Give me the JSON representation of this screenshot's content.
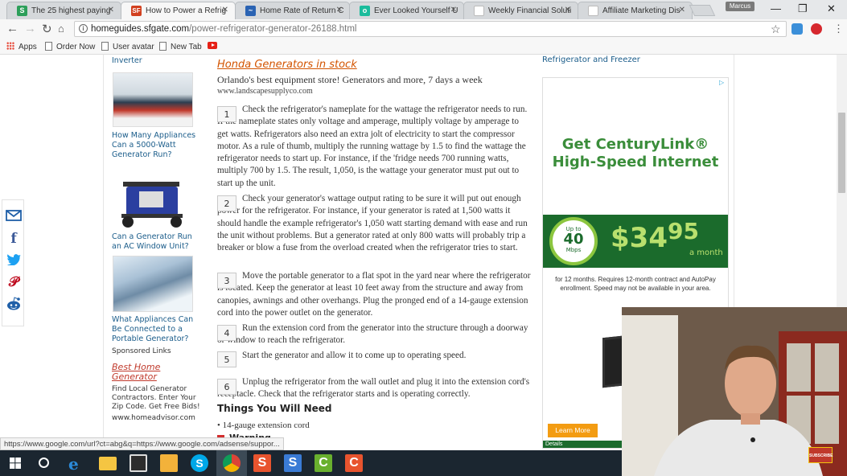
{
  "browser": {
    "tabs": [
      {
        "title": "The 25 highest paying",
        "fav": "S",
        "fav_color": "#2d9f5a"
      },
      {
        "title": "How to Power a Refrig",
        "fav": "SF",
        "fav_color": "#d2401f"
      },
      {
        "title": "Home Rate of Return C",
        "fav": "~",
        "fav_color": "#2a63b3"
      },
      {
        "title": "Ever Looked Yourself U",
        "fav": "o",
        "fav_color": "#1abc9c"
      },
      {
        "title": "Weekly Financial Soluti",
        "fav": "",
        "fav_color": "#cccccc"
      },
      {
        "title": "Affiliate Marketing Dis",
        "fav": "",
        "fav_color": "#cccccc"
      }
    ],
    "user_chip": "Marcus",
    "url_domain": "homeguides.sfgate.com",
    "url_path": "/power-refrigerator-generator-26188.html",
    "bookmarks": [
      "Apps",
      "Order Now",
      "User avatar",
      "New Tab"
    ],
    "status_url": "https://www.google.com/url?ct=abg&q=https://www.google.com/adsense/suppor..."
  },
  "left_column": {
    "top_link": "Inverter",
    "related": [
      "How Many Appliances Can a 5000-Watt Generator Run?",
      "Can a Generator Run an AC Window Unit?",
      "What Appliances Can Be Connected to a Portable Generator?"
    ],
    "sponsored_label": "Sponsored Links",
    "sponsored_title": "Best Home Generator",
    "sponsored_text": "Find Local Generator Contractors. Enter Your Zip Code. Get Free Bids!",
    "sponsored_url": "www.homeadvisor.com"
  },
  "main": {
    "ad_title": "Honda Generators in stock",
    "ad_text": "Orlando's best equipment store! Generators and more, 7 days a week",
    "ad_url": "www.landscapesupplyco.com",
    "steps": [
      {
        "num": "1",
        "text": "Check the refrigerator's nameplate for the wattage the refrigerator needs to run. If the nameplate states only voltage and amperage, multiply voltage by amperage to get watts. Refrigerators also need an extra jolt of electricity to start the compressor motor. As a rule of thumb, multiply the running wattage by 1.5 to find the wattage the refrigerator needs to start up. For instance, if the 'fridge needs 700 running watts, multiply 700 by 1.5. The result, 1,050, is the wattage your generator must put out to start up the unit."
      },
      {
        "num": "2",
        "text": "Check your generator's wattage output rating to be sure it will put out enough power for the refrigerator. For instance, if your generator is rated at 1,500 watts it should handle the example refrigerator's 1,050 watt starting demand with ease and run the unit without problems. But a generator rated at only 800 watts will probably trip a breaker or blow a fuse from the overload created when the refrigerator tries to start."
      },
      {
        "num": "3",
        "text": "Move the portable generator to a flat spot in the yard near where the refrigerator is located. Keep the generator at least 10 feet away from the structure and away from canopies, awnings and other overhangs. Plug the pronged end of a 14-gauge extension cord into the power outlet on the generator."
      },
      {
        "num": "4",
        "text": "Run the extension cord from the generator into the structure through a doorway or window to reach the refrigerator."
      },
      {
        "num": "5",
        "text": "Start the generator and allow it to come up to operating speed."
      },
      {
        "num": "6",
        "text": "Unplug the refrigerator from the wall outlet and plug it into the extension cord's receptacle. Check that the refrigerator starts and is operating correctly."
      }
    ],
    "things_heading": "Things You Will Need",
    "things": [
      "14-gauge extension cord"
    ],
    "warning_label": "Warning"
  },
  "right_column": {
    "title": "Refrigerator and Freezer",
    "ad": {
      "headline": "Get CenturyLink® High-Speed Internet",
      "speed_up": "Up to",
      "speed_num": "40",
      "speed_unit": "Mbps",
      "price_dollar": "$34",
      "price_cents": "95",
      "price_period": "a month",
      "fine_print": "for 12 months. Requires 12-month contract and AutoPay enrollment. Speed may not be available in your area.",
      "cta": "Learn More",
      "details": "Details"
    }
  },
  "webcam": {
    "badge": "SUBSCRIBE"
  }
}
